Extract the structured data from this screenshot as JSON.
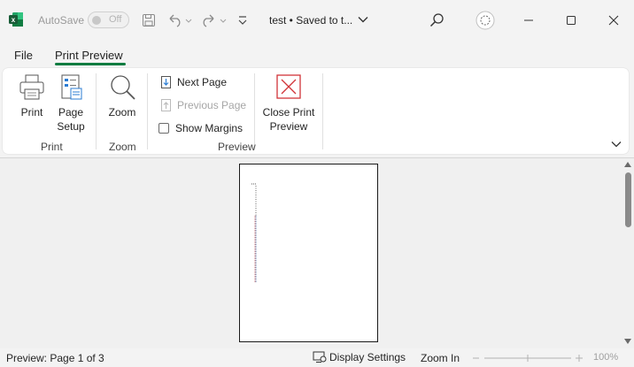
{
  "titlebar": {
    "autosave_label": "AutoSave",
    "autosave_state": "Off",
    "document_title": "test • Saved to t..."
  },
  "tabs": [
    {
      "label": "File",
      "active": false
    },
    {
      "label": "Print Preview",
      "active": true
    }
  ],
  "ribbon": {
    "print_label": "Print",
    "page_setup_line1": "Page",
    "page_setup_line2": "Setup",
    "zoom_label": "Zoom",
    "next_page": "Next Page",
    "previous_page": "Previous Page",
    "show_margins": "Show Margins",
    "close_line1": "Close Print",
    "close_line2": "Preview",
    "groups": {
      "print": "Print",
      "zoom": "Zoom",
      "preview": "Preview"
    }
  },
  "statusbar": {
    "preview_text": "Preview: Page 1 of 3",
    "display_settings": "Display Settings",
    "zoom_in": "Zoom In",
    "zoom_percent": "100%"
  },
  "colors": {
    "accent": "#107c41",
    "close_red": "#d13438"
  },
  "icons": [
    "excel-logo-icon",
    "save-icon",
    "undo-icon",
    "redo-icon",
    "customize-qat-icon",
    "search-icon",
    "copilot-icon",
    "minimize-icon",
    "maximize-icon",
    "close-icon",
    "print-icon",
    "page-setup-icon",
    "zoom-icon",
    "next-page-icon",
    "previous-page-icon",
    "close-print-preview-icon",
    "display-settings-icon"
  ]
}
